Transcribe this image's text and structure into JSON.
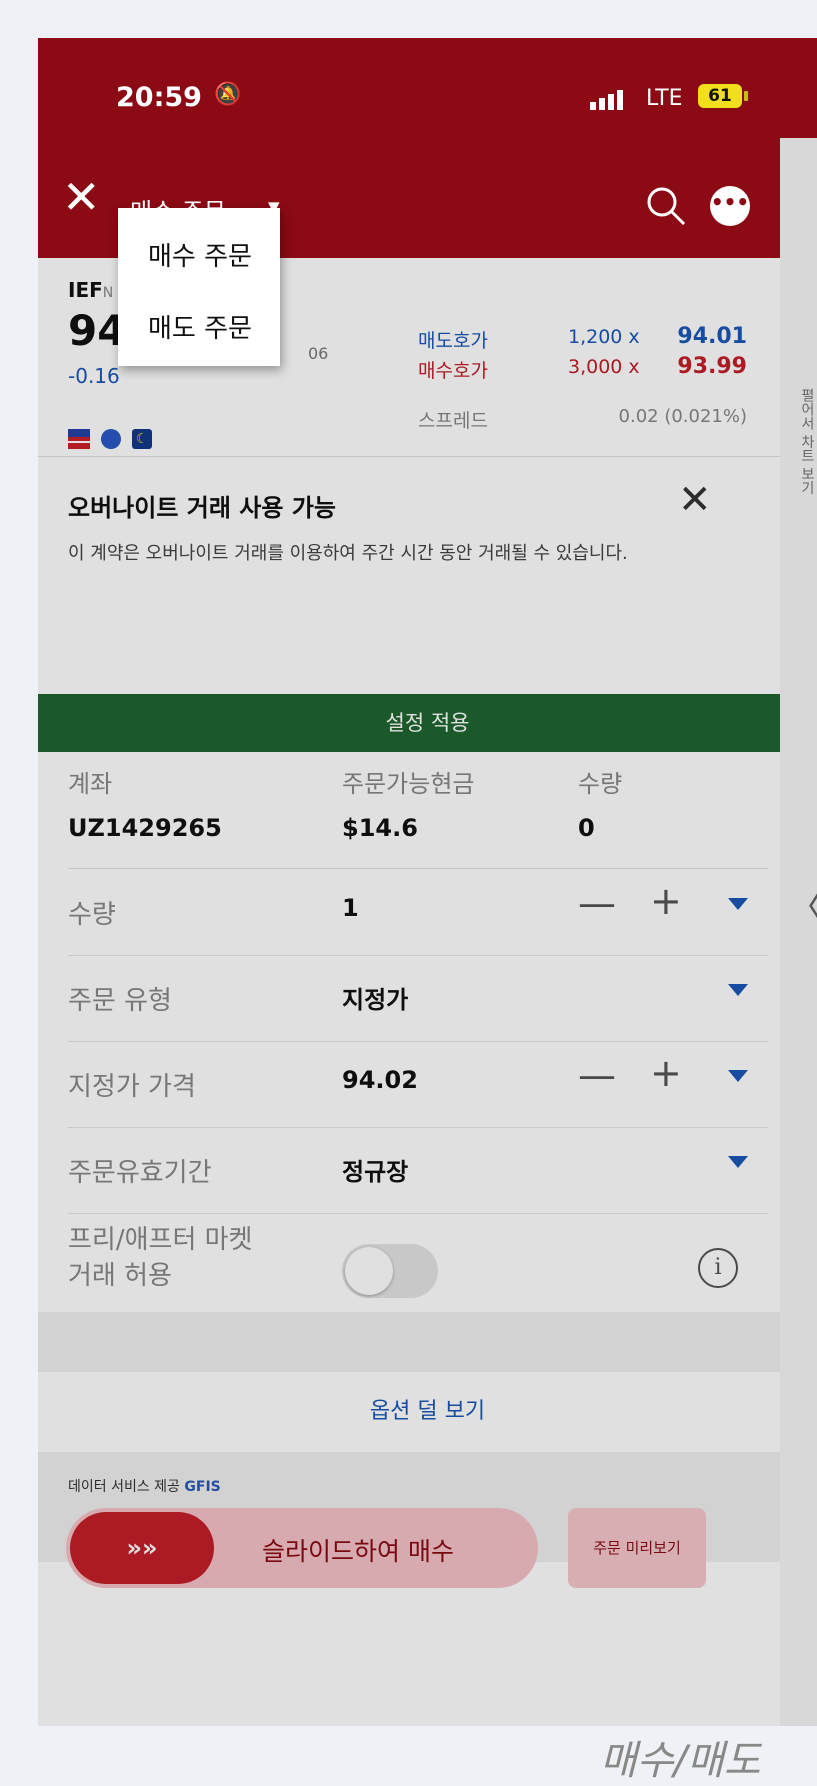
{
  "status_bar": {
    "time": "20:59",
    "network": "LTE",
    "battery": "61"
  },
  "nav": {
    "title": "매수 주문",
    "caret": "▼"
  },
  "order_menu": {
    "items": [
      "매수 주문",
      "매도 주문"
    ]
  },
  "quote": {
    "symbol": "IEF",
    "exchange": "N",
    "price": "94",
    "change": "-0.16",
    "time_fragment": "06",
    "ask_label": "매도호가",
    "ask_qty": "1,200 x",
    "ask_price": "94.01",
    "bid_label": "매수호가",
    "bid_qty": "3,000 x",
    "bid_price": "93.99",
    "spread_label": "스프레드",
    "spread_value": "0.02 (0.021%)"
  },
  "banner": {
    "title": "오버나이트 거래 사용 가능",
    "description": "이 계약은 오버나이트 거래를 이용하여 주간 시간 동안 거래될 수 있습니다.",
    "apply_button": "설정 적용"
  },
  "account": {
    "account_label": "계좌",
    "account_value": "UZ1429265",
    "cash_label": "주문가능현금",
    "cash_value": "$14.6",
    "qty_label": "수량",
    "qty_value": "0"
  },
  "form": {
    "quantity_label": "수량",
    "quantity_value": "1",
    "order_type_label": "주문 유형",
    "order_type_value": "지정가",
    "limit_price_label": "지정가 가격",
    "limit_price_value": "94.02",
    "tif_label": "주문유효기간",
    "tif_value": "정규장",
    "prepost_label_line1": "프리/애프터 마켓",
    "prepost_label_line2": "거래 허용",
    "prepost_enabled": false
  },
  "more_options": "옵션 덜 보기",
  "data_provider_text": "데이터 서비스 제공",
  "data_provider_name": "GFIS",
  "slide_button_label": "슬라이드하여 매수",
  "slide_button_icon": "»»",
  "preview_button_label": "주문 미리보기",
  "side_rail_label": "펼어서 차트 보기",
  "colors": {
    "brand": "#8b0a14",
    "accent_blue": "#1a58b8",
    "accent_red": "#c41e2a",
    "apply_green": "#206630"
  },
  "caption": "매수/매도"
}
